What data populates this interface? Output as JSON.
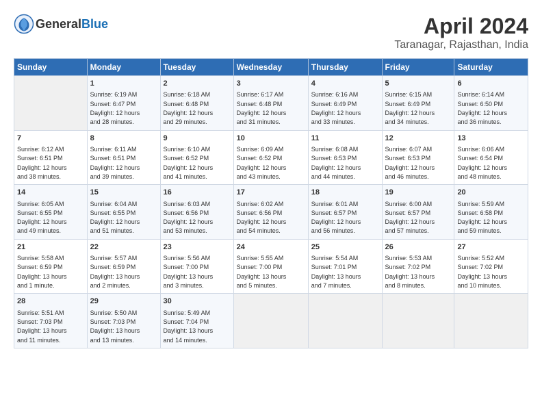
{
  "header": {
    "logo_general": "General",
    "logo_blue": "Blue",
    "month": "April 2024",
    "location": "Taranagar, Rajasthan, India"
  },
  "calendar": {
    "days_of_week": [
      "Sunday",
      "Monday",
      "Tuesday",
      "Wednesday",
      "Thursday",
      "Friday",
      "Saturday"
    ],
    "weeks": [
      [
        {
          "day": "",
          "content": ""
        },
        {
          "day": "1",
          "content": "Sunrise: 6:19 AM\nSunset: 6:47 PM\nDaylight: 12 hours\nand 28 minutes."
        },
        {
          "day": "2",
          "content": "Sunrise: 6:18 AM\nSunset: 6:48 PM\nDaylight: 12 hours\nand 29 minutes."
        },
        {
          "day": "3",
          "content": "Sunrise: 6:17 AM\nSunset: 6:48 PM\nDaylight: 12 hours\nand 31 minutes."
        },
        {
          "day": "4",
          "content": "Sunrise: 6:16 AM\nSunset: 6:49 PM\nDaylight: 12 hours\nand 33 minutes."
        },
        {
          "day": "5",
          "content": "Sunrise: 6:15 AM\nSunset: 6:49 PM\nDaylight: 12 hours\nand 34 minutes."
        },
        {
          "day": "6",
          "content": "Sunrise: 6:14 AM\nSunset: 6:50 PM\nDaylight: 12 hours\nand 36 minutes."
        }
      ],
      [
        {
          "day": "7",
          "content": "Sunrise: 6:12 AM\nSunset: 6:51 PM\nDaylight: 12 hours\nand 38 minutes."
        },
        {
          "day": "8",
          "content": "Sunrise: 6:11 AM\nSunset: 6:51 PM\nDaylight: 12 hours\nand 39 minutes."
        },
        {
          "day": "9",
          "content": "Sunrise: 6:10 AM\nSunset: 6:52 PM\nDaylight: 12 hours\nand 41 minutes."
        },
        {
          "day": "10",
          "content": "Sunrise: 6:09 AM\nSunset: 6:52 PM\nDaylight: 12 hours\nand 43 minutes."
        },
        {
          "day": "11",
          "content": "Sunrise: 6:08 AM\nSunset: 6:53 PM\nDaylight: 12 hours\nand 44 minutes."
        },
        {
          "day": "12",
          "content": "Sunrise: 6:07 AM\nSunset: 6:53 PM\nDaylight: 12 hours\nand 46 minutes."
        },
        {
          "day": "13",
          "content": "Sunrise: 6:06 AM\nSunset: 6:54 PM\nDaylight: 12 hours\nand 48 minutes."
        }
      ],
      [
        {
          "day": "14",
          "content": "Sunrise: 6:05 AM\nSunset: 6:55 PM\nDaylight: 12 hours\nand 49 minutes."
        },
        {
          "day": "15",
          "content": "Sunrise: 6:04 AM\nSunset: 6:55 PM\nDaylight: 12 hours\nand 51 minutes."
        },
        {
          "day": "16",
          "content": "Sunrise: 6:03 AM\nSunset: 6:56 PM\nDaylight: 12 hours\nand 53 minutes."
        },
        {
          "day": "17",
          "content": "Sunrise: 6:02 AM\nSunset: 6:56 PM\nDaylight: 12 hours\nand 54 minutes."
        },
        {
          "day": "18",
          "content": "Sunrise: 6:01 AM\nSunset: 6:57 PM\nDaylight: 12 hours\nand 56 minutes."
        },
        {
          "day": "19",
          "content": "Sunrise: 6:00 AM\nSunset: 6:57 PM\nDaylight: 12 hours\nand 57 minutes."
        },
        {
          "day": "20",
          "content": "Sunrise: 5:59 AM\nSunset: 6:58 PM\nDaylight: 12 hours\nand 59 minutes."
        }
      ],
      [
        {
          "day": "21",
          "content": "Sunrise: 5:58 AM\nSunset: 6:59 PM\nDaylight: 13 hours\nand 1 minute."
        },
        {
          "day": "22",
          "content": "Sunrise: 5:57 AM\nSunset: 6:59 PM\nDaylight: 13 hours\nand 2 minutes."
        },
        {
          "day": "23",
          "content": "Sunrise: 5:56 AM\nSunset: 7:00 PM\nDaylight: 13 hours\nand 3 minutes."
        },
        {
          "day": "24",
          "content": "Sunrise: 5:55 AM\nSunset: 7:00 PM\nDaylight: 13 hours\nand 5 minutes."
        },
        {
          "day": "25",
          "content": "Sunrise: 5:54 AM\nSunset: 7:01 PM\nDaylight: 13 hours\nand 7 minutes."
        },
        {
          "day": "26",
          "content": "Sunrise: 5:53 AM\nSunset: 7:02 PM\nDaylight: 13 hours\nand 8 minutes."
        },
        {
          "day": "27",
          "content": "Sunrise: 5:52 AM\nSunset: 7:02 PM\nDaylight: 13 hours\nand 10 minutes."
        }
      ],
      [
        {
          "day": "28",
          "content": "Sunrise: 5:51 AM\nSunset: 7:03 PM\nDaylight: 13 hours\nand 11 minutes."
        },
        {
          "day": "29",
          "content": "Sunrise: 5:50 AM\nSunset: 7:03 PM\nDaylight: 13 hours\nand 13 minutes."
        },
        {
          "day": "30",
          "content": "Sunrise: 5:49 AM\nSunset: 7:04 PM\nDaylight: 13 hours\nand 14 minutes."
        },
        {
          "day": "",
          "content": ""
        },
        {
          "day": "",
          "content": ""
        },
        {
          "day": "",
          "content": ""
        },
        {
          "day": "",
          "content": ""
        }
      ]
    ]
  }
}
